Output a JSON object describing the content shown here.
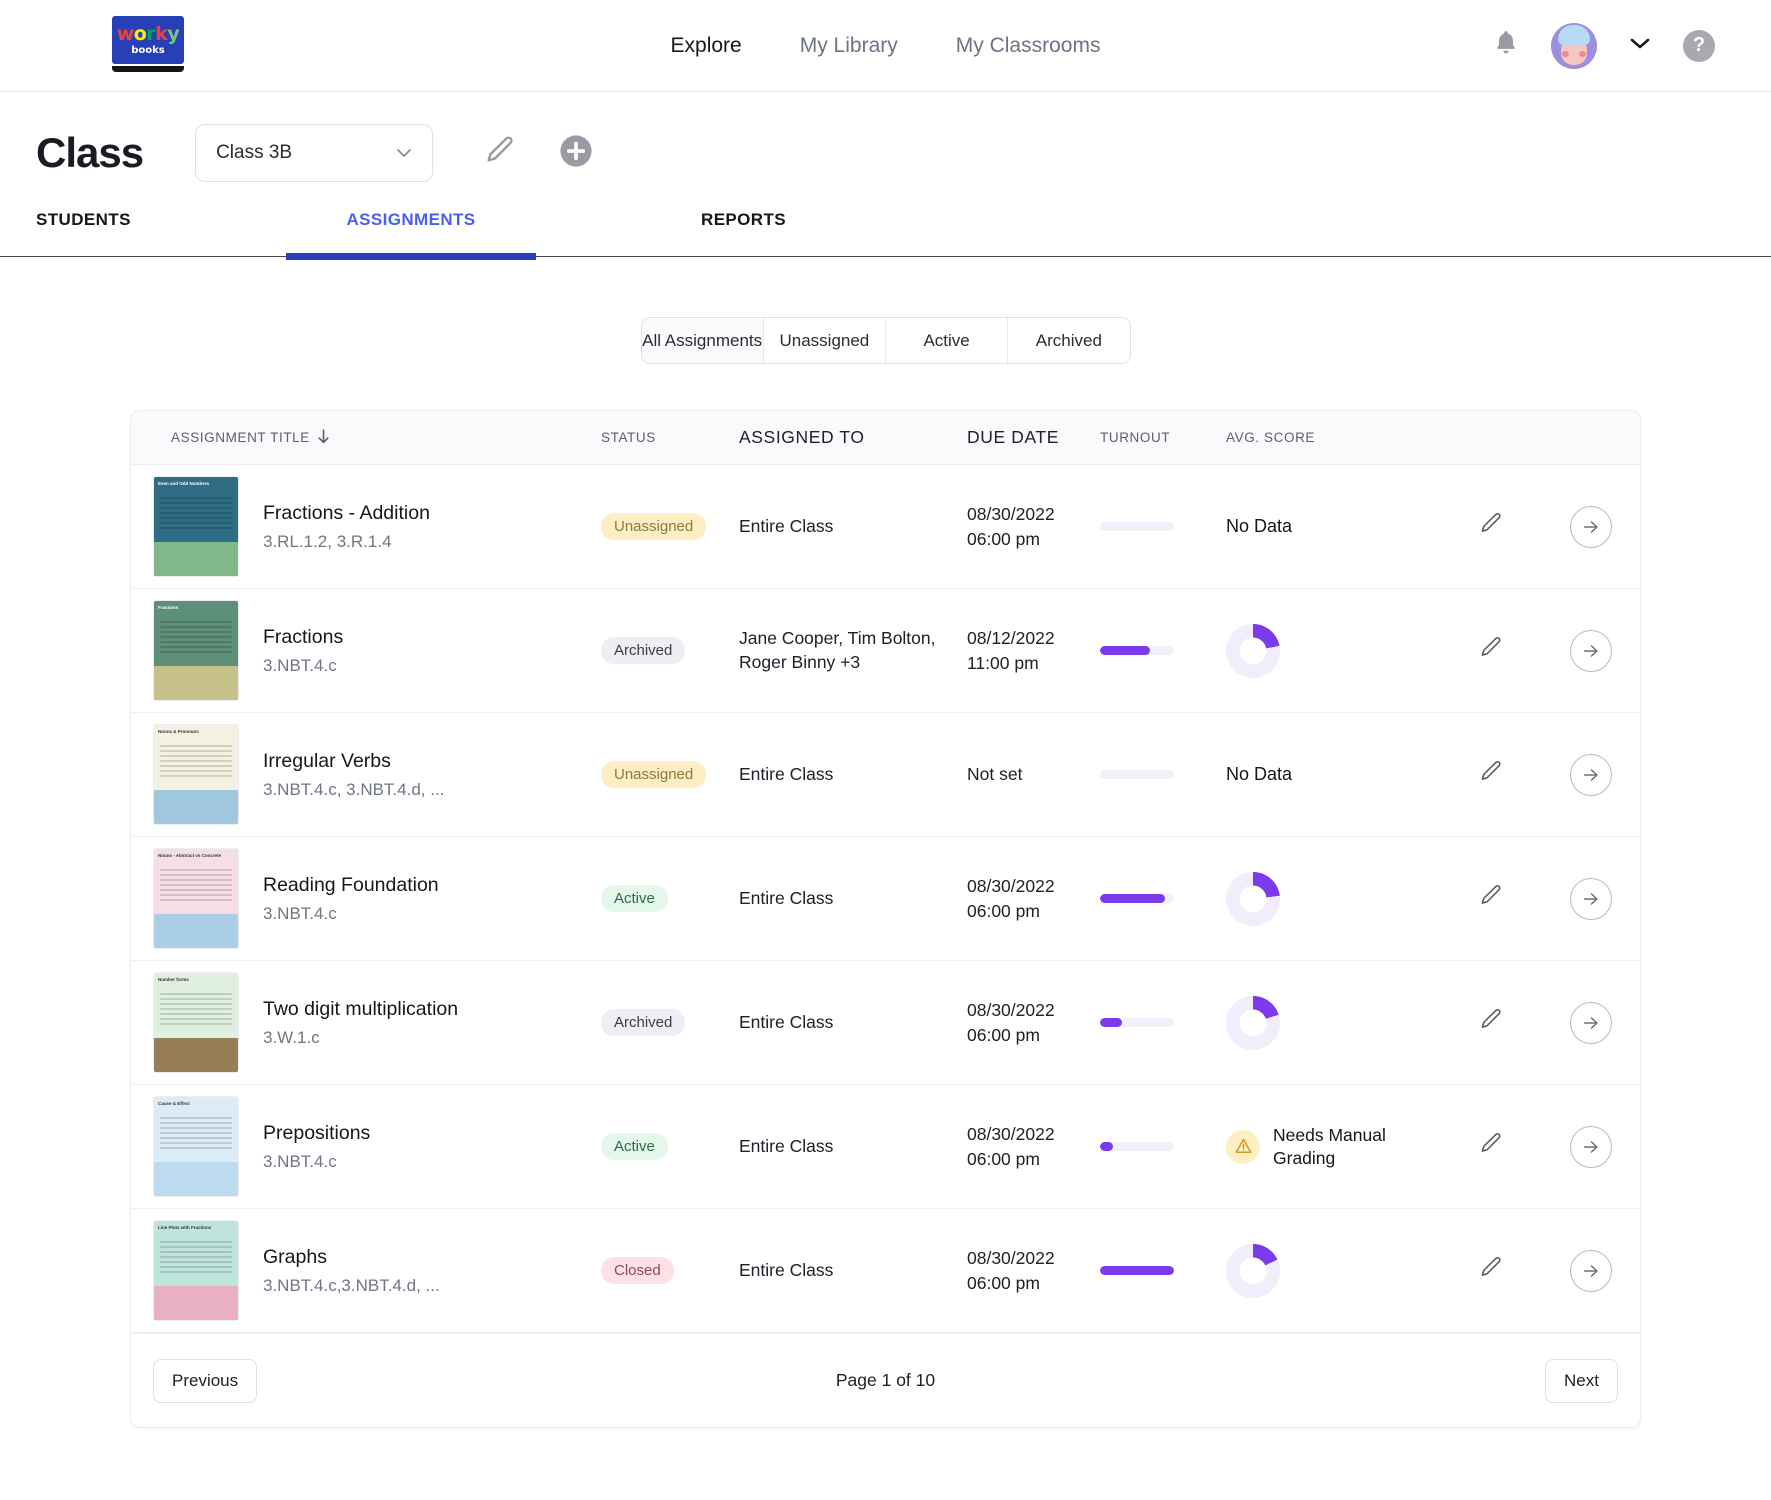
{
  "header": {
    "logo": {
      "word_letters": [
        "w",
        "o",
        "r",
        "k",
        "y"
      ],
      "sub": "books",
      "name": "workybooks-logo"
    },
    "nav": [
      {
        "label": "Explore",
        "active": true
      },
      {
        "label": "My Library",
        "active": false
      },
      {
        "label": "My Classrooms",
        "active": false
      }
    ],
    "icons": {
      "bell": "bell-icon",
      "avatar": "user-avatar",
      "chevron": "chevron-down-icon",
      "help": "?"
    }
  },
  "classbar": {
    "title": "Class",
    "selected_class": "Class 3B",
    "edit_icon": "pencil-icon",
    "add_icon": "plus-circle-icon"
  },
  "tabs": [
    {
      "label": "STUDENTS",
      "active": false
    },
    {
      "label": "ASSIGNMENTS",
      "active": true
    },
    {
      "label": "REPORTS",
      "active": false
    }
  ],
  "filters": [
    {
      "label": "All Assignments",
      "selected": true
    },
    {
      "label": "Unassigned",
      "selected": false
    },
    {
      "label": "Active",
      "selected": false
    },
    {
      "label": "Archived",
      "selected": false
    }
  ],
  "table": {
    "columns": [
      "ASSIGNMENT TITLE",
      "STATUS",
      "ASSIGNED TO",
      "DUE DATE",
      "TURNOUT",
      "AVG. SCORE"
    ],
    "sort_icon": "arrow-down-icon",
    "rows": [
      {
        "thumb": {
          "title": "Even and Odd Numbers",
          "bg": "#2e6d84",
          "accent": "#8fc48a"
        },
        "title": "Fractions - Addition",
        "standards": "3.RL.1.2, 3.R.1.4",
        "status": "Unassigned",
        "status_kind": "unassigned",
        "assigned_to": "Entire Class",
        "due_date": "08/30/2022",
        "due_time": "06:00 pm",
        "turnout_pct": 0,
        "score_kind": "nodata",
        "score_text": "No Data",
        "score_pct": 0
      },
      {
        "thumb": {
          "title": "Fractions",
          "bg": "#5d8f7b",
          "accent": "#d8c98c"
        },
        "title": "Fractions",
        "standards": "3.NBT.4.c",
        "status": "Archived",
        "status_kind": "archived",
        "assigned_to": "Jane Cooper, Tim Bolton, Roger Binny +3",
        "due_date": "08/12/2022",
        "due_time": "11:00 pm",
        "turnout_pct": 68,
        "score_kind": "donut",
        "score_text": "",
        "score_pct": 22
      },
      {
        "thumb": {
          "title": "Nouns & Pronouns",
          "bg": "#f4f0e2",
          "accent": "#8fc0dd"
        },
        "title": "Irregular Verbs",
        "standards": "3.NBT.4.c, 3.NBT.4.d, ...",
        "status": "Unassigned",
        "status_kind": "unassigned",
        "assigned_to": "Entire Class",
        "due_date": "Not set",
        "due_time": "",
        "turnout_pct": 0,
        "score_kind": "nodata",
        "score_text": "No Data",
        "score_pct": 0
      },
      {
        "thumb": {
          "title": "Nouns - Abstract vs Concrete",
          "bg": "#f6dfe4",
          "accent": "#9ecbe8"
        },
        "title": "Reading Foundation",
        "standards": "3.NBT.4.c",
        "status": "Active",
        "status_kind": "active",
        "assigned_to": "Entire Class",
        "due_date": "08/30/2022",
        "due_time": "06:00 pm",
        "turnout_pct": 88,
        "score_kind": "donut",
        "score_text": "",
        "score_pct": 23
      },
      {
        "thumb": {
          "title": "Number forms",
          "bg": "#dff0e0",
          "accent": "#8a6a3e"
        },
        "title": "Two digit multiplication",
        "standards": "3.W.1.c",
        "status": "Archived",
        "status_kind": "archived",
        "assigned_to": "Entire Class",
        "due_date": "08/30/2022",
        "due_time": "06:00 pm",
        "turnout_pct": 30,
        "score_kind": "donut",
        "score_text": "",
        "score_pct": 20
      },
      {
        "thumb": {
          "title": "Cause & Effect",
          "bg": "#dcecf7",
          "accent": "#b6d8ec"
        },
        "title": "Prepositions",
        "standards": "3.NBT.4.c",
        "status": "Active",
        "status_kind": "active",
        "assigned_to": "Entire Class",
        "due_date": "08/30/2022",
        "due_time": "06:00 pm",
        "turnout_pct": 17,
        "score_kind": "manual",
        "score_text": "Needs Manual Grading",
        "score_pct": 0
      },
      {
        "thumb": {
          "title": "Line Plots with Fractions",
          "bg": "#bfe4de",
          "accent": "#f0a6bd"
        },
        "title": "Graphs",
        "standards": "3.NBT.4.c,3.NBT.4.d, ...",
        "status": "Closed",
        "status_kind": "closed",
        "assigned_to": "Entire Class",
        "due_date": "08/30/2022",
        "due_time": "06:00 pm",
        "turnout_pct": 100,
        "score_kind": "donut",
        "score_text": "",
        "score_pct": 18
      }
    ],
    "row_edit_icon": "pencil-icon",
    "row_go_icon": "arrow-right-circle-icon"
  },
  "pagination": {
    "previous": "Previous",
    "page_text": "Page 1 of 10",
    "next": "Next"
  },
  "colors": {
    "accent_purple": "#7c3aed",
    "tab_blue": "#4a5ef0",
    "tab_underline": "#2740b8",
    "donut_track": "#f2edfb"
  }
}
